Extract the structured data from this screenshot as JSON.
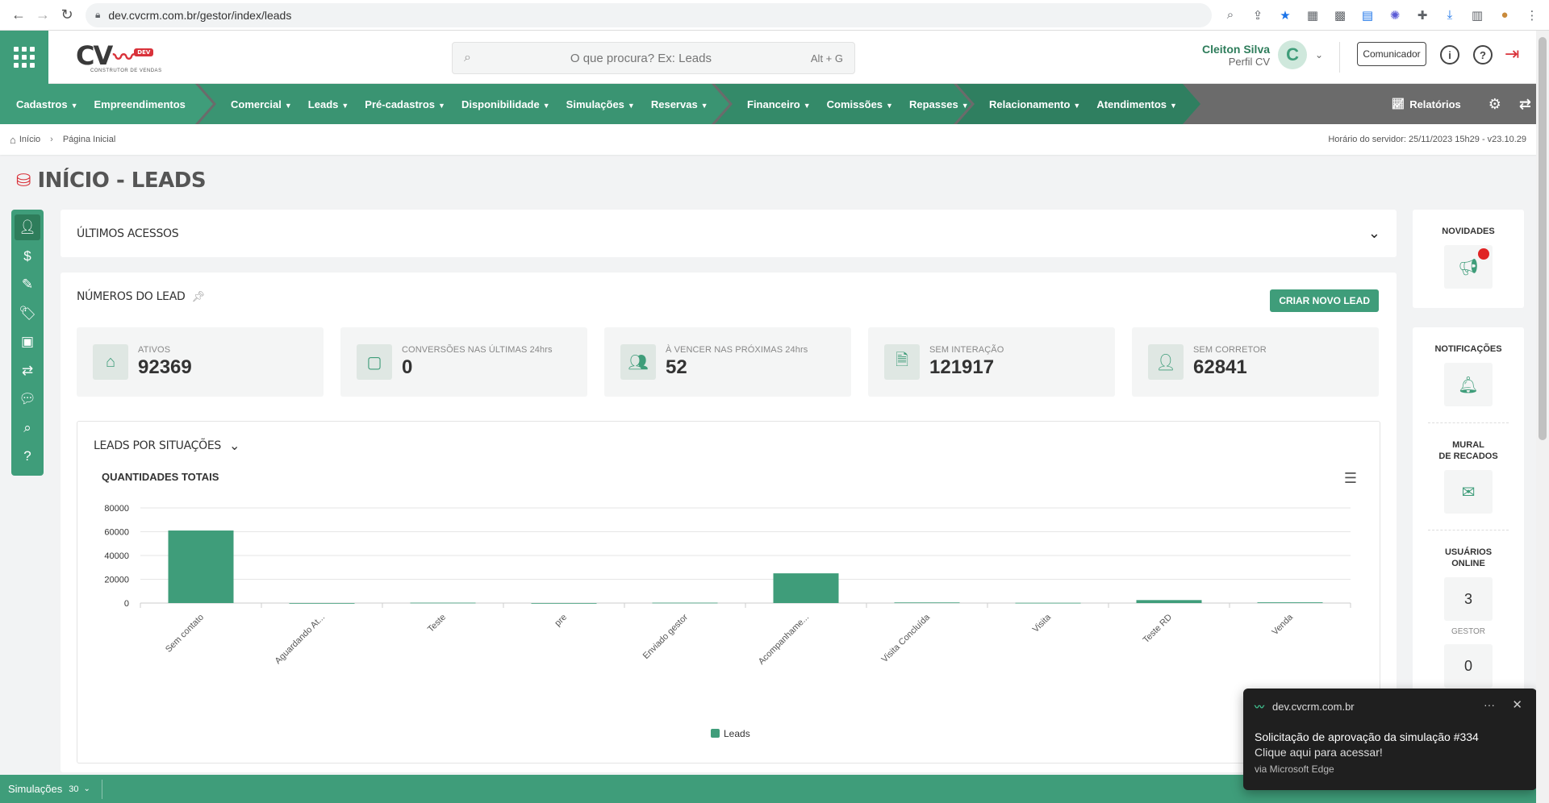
{
  "browser": {
    "url": "dev.cvcrm.com.br/gestor/index/leads"
  },
  "header": {
    "logo_text": "CV",
    "logo_badge": "DEV",
    "logo_sub": "CONSTRUTOR DE VENDAS",
    "search_placeholder": "O que procura? Ex: Leads",
    "search_shortcut": "Alt + G",
    "user_name": "Cleiton Silva",
    "user_profile": "Perfil CV",
    "avatar_letter": "C",
    "communicator_label": "Comunicador"
  },
  "nav": {
    "groups": [
      {
        "items": [
          "Cadastros",
          "Empreendimentos"
        ],
        "carets": [
          true,
          false
        ]
      },
      {
        "items": [
          "Comercial",
          "Leads",
          "Pré-cadastros",
          "Disponibilidade",
          "Simulações",
          "Reservas"
        ],
        "carets": [
          true,
          true,
          true,
          true,
          true,
          true
        ]
      },
      {
        "items": [
          "Financeiro",
          "Comissões",
          "Repasses"
        ],
        "carets": [
          true,
          true,
          true
        ]
      },
      {
        "items": [
          "Relacionamento",
          "Atendimentos"
        ],
        "carets": [
          true,
          true
        ]
      }
    ],
    "reports_label": "Relatórios"
  },
  "breadcrumb": {
    "home": "Início",
    "current": "Página Inicial",
    "server_time": "Horário do servidor: 25/11/2023 15h29 - v23.10.29"
  },
  "page": {
    "title": "INÍCIO - LEADS"
  },
  "ultimos_acessos": {
    "title": "ÚLTIMOS ACESSOS"
  },
  "numeros": {
    "title": "NÚMEROS DO LEAD",
    "create_button": "CRIAR NOVO LEAD",
    "cards": [
      {
        "label": "ATIVOS",
        "value": "92369",
        "icon": "home-icon"
      },
      {
        "label": "CONVERSÕES NAS ÚLTIMAS 24hrs",
        "value": "0",
        "icon": "contact-icon"
      },
      {
        "label": "À VENCER NAS PRÓXIMAS 24hrs",
        "value": "52",
        "icon": "users-icon"
      },
      {
        "label": "SEM INTERAÇÃO",
        "value": "121917",
        "icon": "document-icon"
      },
      {
        "label": "SEM CORRETOR",
        "value": "62841",
        "icon": "user-icon"
      }
    ]
  },
  "leads_situacoes": {
    "title": "LEADS POR SITUAÇÕES",
    "subtitle": "QUANTIDADES TOTAIS"
  },
  "chart_data": {
    "type": "bar",
    "title": "QUANTIDADES TOTAIS",
    "categories": [
      "Sem contato",
      "Aguardando At...",
      "Teste",
      "pre",
      "Enviado gestor",
      "Acompanhame...",
      "Visita Concluída",
      "Visita",
      "Teste RD",
      "Venda"
    ],
    "series": [
      {
        "name": "Leads",
        "values": [
          61000,
          0,
          300,
          0,
          300,
          25000,
          500,
          200,
          2500,
          600
        ],
        "color": "#3f9d7a"
      }
    ],
    "yticks": [
      0,
      20000,
      40000,
      60000,
      80000
    ],
    "ylim": [
      0,
      80000
    ],
    "grid": true,
    "legend": "bottom"
  },
  "right": {
    "novidades": "NOVIDADES",
    "notificacoes": "NOTIFICAÇÕES",
    "mural_line1": "MURAL",
    "mural_line2": "DE RECADOS",
    "usuarios_line1": "USUÁRIOS",
    "usuarios_line2": "ONLINE",
    "usuarios_count": "3",
    "gestor_label": "GESTOR",
    "next_count": "0"
  },
  "footer": {
    "label": "Simulações",
    "count": "30"
  },
  "toast": {
    "domain": "dev.cvcrm.com.br",
    "title": "Solicitação de aprovação da simulação #334",
    "body": "Clique aqui para acessar!",
    "via": "via Microsoft Edge"
  }
}
